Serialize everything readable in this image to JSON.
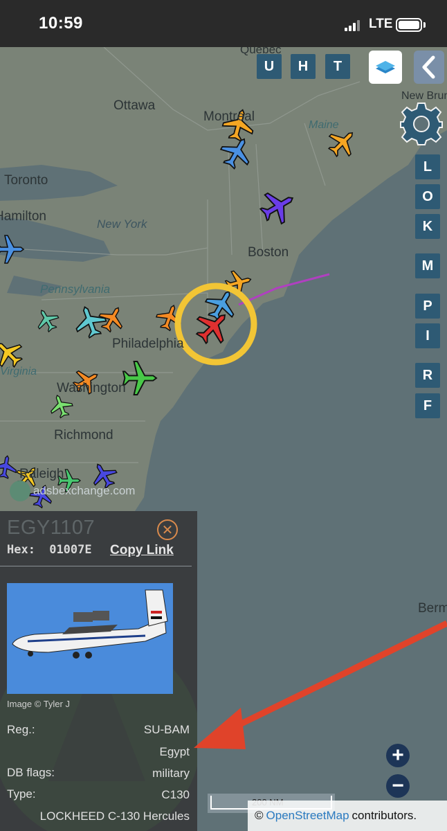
{
  "status_bar": {
    "time": "10:59",
    "network": "LTE",
    "battery": 1.0
  },
  "map": {
    "place_labels": [
      {
        "name": "Quebec"
      },
      {
        "name": "Ottawa"
      },
      {
        "name": "Montréal"
      },
      {
        "name": "Toronto"
      },
      {
        "name": "Hamilton"
      },
      {
        "name": "New York"
      },
      {
        "name": "Maine"
      },
      {
        "name": "Boston"
      },
      {
        "name": "Pennsylvania"
      },
      {
        "name": "New Brunswick"
      },
      {
        "name": "Philadelphia"
      },
      {
        "name": "Virginia"
      },
      {
        "name": "Washington"
      },
      {
        "name": "Richmond"
      },
      {
        "name": "Raleigh"
      },
      {
        "name": "Bermuda"
      }
    ],
    "watermark": "adsbexchange.com",
    "scale_label": "200 NM",
    "attribution": {
      "prefix": "©",
      "link": "OpenStreetMap",
      "suffix": "contributors."
    },
    "zoom_in": "+",
    "zoom_out": "−",
    "colors": {
      "water": "#5f7176",
      "land": "#7a8377",
      "highlight_ring": "#f2c535",
      "annotation_arrow": "#e0432a",
      "track": "#b040c0"
    }
  },
  "toolbar": {
    "top_buttons": [
      "U",
      "H",
      "T"
    ],
    "side_buttons": [
      "L",
      "O",
      "K",
      "M",
      "P",
      "I",
      "R",
      "F"
    ],
    "layers_icon": "layers-icon",
    "collapse_icon": "chevron-left-icon",
    "settings_icon": "gear-icon"
  },
  "aircraft_panel": {
    "callsign": "EGY1107",
    "hex_label": "Hex:",
    "hex_value": "01007E",
    "copy_link": "Copy Link",
    "image_credit": "Image © Tyler J",
    "fields": [
      {
        "label": "Reg.:",
        "value": "SU-BAM"
      },
      {
        "label": "",
        "value": "Egypt"
      },
      {
        "label": "DB flags:",
        "value": "military"
      },
      {
        "label": "Type:",
        "value": "C130"
      },
      {
        "label": "",
        "value": "LOCKHEED C-130 Hercules"
      }
    ]
  }
}
